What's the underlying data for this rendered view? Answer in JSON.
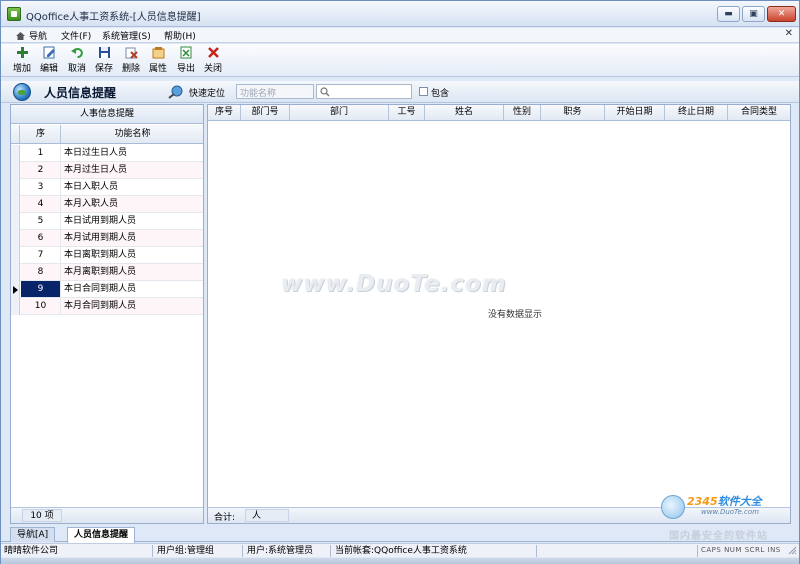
{
  "window": {
    "title": "QQoffice人事工资系统-[人员信息提醒]",
    "buttons": {
      "minimize": "▬",
      "maximize": "▣",
      "close": "✕"
    }
  },
  "menu": {
    "items": [
      "导航",
      "文件(F)",
      "系统管理(S)",
      "帮助(H)"
    ],
    "close_mdi": "✕"
  },
  "toolbar": {
    "buttons": [
      {
        "label": "增加",
        "icon": "add-icon",
        "color": "#2e7d32"
      },
      {
        "label": "编辑",
        "icon": "edit-icon",
        "color": "#3c6fb0"
      },
      {
        "label": "取消",
        "icon": "undo-icon",
        "color": "#2e9a3a"
      },
      {
        "label": "保存",
        "icon": "save-icon",
        "color": "#2c4f9c"
      },
      {
        "label": "删除",
        "icon": "delete-icon",
        "color": "#b33a2a"
      },
      {
        "label": "属性",
        "icon": "properties-icon",
        "color": "#c07a1c"
      },
      {
        "label": "导出",
        "icon": "export-icon",
        "color": "#2e8b3e"
      },
      {
        "label": "关闭",
        "icon": "close-icon",
        "color": "#c4231a"
      }
    ]
  },
  "header": {
    "heading": "人员信息提醒",
    "quick_locate_label": "快速定位",
    "field_placeholder": "功能名称",
    "search_value": "",
    "contains_label": "包含",
    "contains_checked": false
  },
  "left_panel": {
    "title": "人事信息提醒",
    "columns": [
      "序",
      "功能名称"
    ],
    "rows": [
      {
        "no": "1",
        "name": "本日过生日人员"
      },
      {
        "no": "2",
        "name": "本月过生日人员"
      },
      {
        "no": "3",
        "name": "本日入职人员"
      },
      {
        "no": "4",
        "name": "本月入职人员"
      },
      {
        "no": "5",
        "name": "本日试用到期人员"
      },
      {
        "no": "6",
        "name": "本月试用到期人员"
      },
      {
        "no": "7",
        "name": "本日离职到期人员"
      },
      {
        "no": "8",
        "name": "本月离职到期人员"
      },
      {
        "no": "9",
        "name": "本日合同到期人员"
      },
      {
        "no": "10",
        "name": "本月合同到期人员"
      }
    ],
    "selected_row": 9,
    "count_text": "10 项"
  },
  "grid": {
    "columns": [
      "序号",
      "部门号",
      "部门",
      "工号",
      "姓名",
      "性别",
      "职务",
      "开始日期",
      "终止日期",
      "合同类型"
    ],
    "empty_message": "没有数据显示",
    "watermark": "www.DuoTe.com",
    "sum_label": "合计:",
    "sum_unit": "人"
  },
  "tabs": [
    {
      "label": "导航[A]",
      "active": false
    },
    {
      "label": "人员信息提醒",
      "active": true
    }
  ],
  "status": {
    "company": "晴晴软件公司",
    "user_group": "用户组:管理组",
    "user": "用户:系统管理员",
    "account": "当前帐套:QQoffice人事工资系统",
    "keys": "CAPS NUM SCRL INS"
  },
  "badge": {
    "brand_a": "2345",
    "brand_b": "软件大全",
    "url": "www.DuoTe.com",
    "slogan": "国内最安全的软件站"
  }
}
